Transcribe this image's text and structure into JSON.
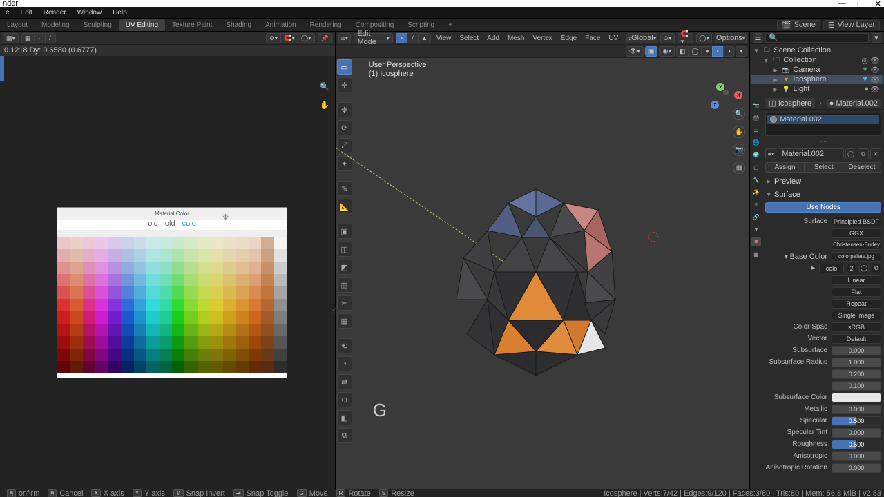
{
  "app_title": "nder",
  "main_menu": [
    "e",
    "Edit",
    "Render",
    "Window",
    "Help"
  ],
  "workspace_tabs": [
    "Layout",
    "Modeling",
    "Sculpting",
    "UV Editing",
    "Texture Paint",
    "Shading",
    "Animation",
    "Rendering",
    "Compositing",
    "Scripting",
    "+"
  ],
  "workspace_active": "UV Editing",
  "top_right": {
    "scene": "Scene",
    "view_layer": "View Layer"
  },
  "uv": {
    "status": "0.1218   Dy: 0.6580 (0.6777)",
    "palette_title": "Material Color",
    "palette_tabs": [
      "old",
      "old",
      "colo"
    ],
    "cursor_move_hint": "⤡"
  },
  "v3d": {
    "mode": "Edit Mode",
    "header_menus": [
      "View",
      "Select",
      "Add",
      "Mesh",
      "Vertex",
      "Edge",
      "Face",
      "UV"
    ],
    "orientation": "Global",
    "options": "Options",
    "overlay_line1": "User Perspective",
    "overlay_line2": "(1) Icosphere",
    "bigkey": "G"
  },
  "outliner": {
    "root": "Scene Collection",
    "collection": "Collection",
    "items": [
      "Camera",
      "Icosphere",
      "Light"
    ],
    "selected": "Icosphere"
  },
  "props": {
    "object": "Icosphere",
    "material_chip": "Material.002",
    "slot_name": "Material.002",
    "mat_name": "Material.002",
    "assign_row": [
      "Assign",
      "Select",
      "Deselect"
    ],
    "panels": {
      "preview": "Preview",
      "surface": "Surface"
    },
    "use_nodes": "Use Nodes",
    "rows": {
      "surface": {
        "label": "Surface",
        "value": "Principled BSDF"
      },
      "dist": {
        "label": "",
        "value": "GGX"
      },
      "sssm": {
        "label": "",
        "value": "Christensen-Burley"
      },
      "base": {
        "label": "Base Color",
        "value": "colorpalete.jpg"
      },
      "tex2": {
        "label": "",
        "value": "colo",
        "num": "2"
      },
      "interp": {
        "label": "",
        "value": "Linear"
      },
      "proj": {
        "label": "",
        "value": "Flat"
      },
      "ext": {
        "label": "",
        "value": "Repeat"
      },
      "src": {
        "label": "",
        "value": "Single Image"
      },
      "cspace": {
        "label": "Color Spac",
        "value": "sRGB"
      },
      "vector": {
        "label": "Vector",
        "value": "Default"
      },
      "subsurf": {
        "label": "Subsurface",
        "value": "0.000"
      },
      "sssr": {
        "label": "Subsurface Radius",
        "v1": "1.000",
        "v2": "0.200",
        "v3": "0.100"
      },
      "sssc": {
        "label": "Subsurface Color"
      },
      "metal": {
        "label": "Metallic",
        "value": "0.000"
      },
      "spec": {
        "label": "Specular",
        "value": "0.500"
      },
      "spect": {
        "label": "Specular Tint",
        "value": "0.000"
      },
      "rough": {
        "label": "Roughness",
        "value": "0.500"
      },
      "aniso": {
        "label": "Anisotropic",
        "value": "0.000"
      },
      "anisor": {
        "label": "Anisotropic Rotation",
        "value": "0.000"
      }
    }
  },
  "status": {
    "left": [
      {
        "key": "",
        "label": "onfirm"
      },
      {
        "key": "",
        "label": "Cancel"
      },
      {
        "key": "X",
        "label": "X axis"
      },
      {
        "key": "Y",
        "label": "Y axis"
      },
      {
        "key": "",
        "label": "Snap Invert"
      },
      {
        "key": "",
        "label": "Snap Toggle"
      },
      {
        "key": "G",
        "label": "Move"
      },
      {
        "key": "R",
        "label": "Rotate"
      },
      {
        "key": "S",
        "label": "Resize"
      }
    ],
    "right": "Icosphere | Verts:7/42 | Edges:9/120 | Faces:3/80 | Tris:80 | Mem: 56.8 MiB | v2.83"
  }
}
